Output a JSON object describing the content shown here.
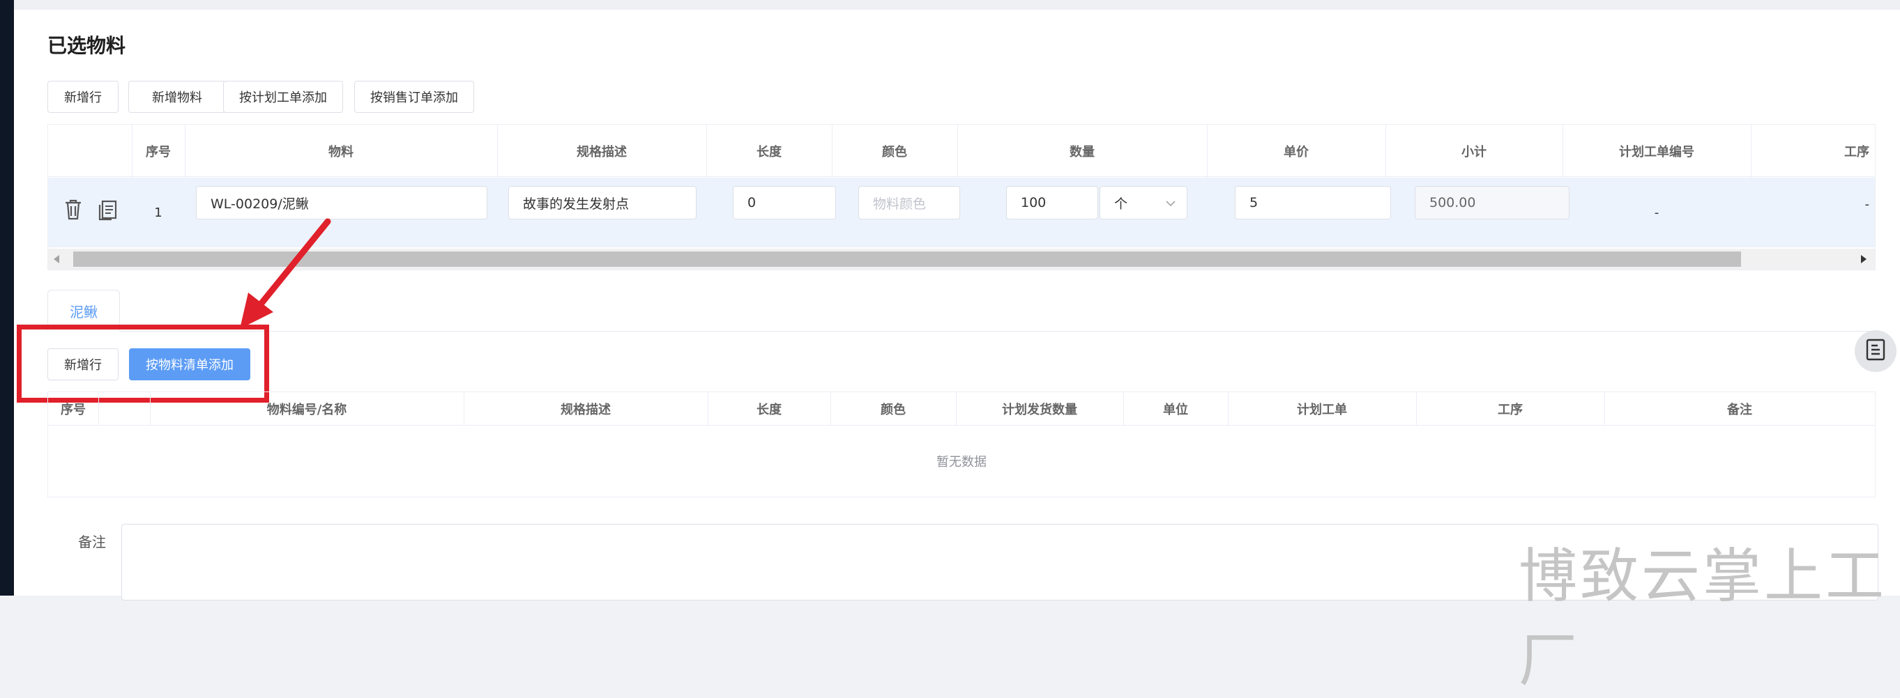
{
  "section": {
    "title": "已选物料"
  },
  "toolbar_top": {
    "buttons": [
      "新增行",
      "新增物料",
      "按计划工单添加",
      "按销售订单添加"
    ]
  },
  "table1": {
    "headers": [
      "序号",
      "物料",
      "规格描述",
      "长度",
      "颜色",
      "数量",
      "单价",
      "小计",
      "计划工单编号",
      "工序"
    ],
    "row": {
      "index": "1",
      "material": "WL-00209/泥鳅",
      "spec": "故事的发生发射点",
      "length": "0",
      "color_placeholder": "物料颜色",
      "quantity": "100",
      "unit": "个",
      "price": "5",
      "subtotal": "500.00",
      "plan_order": "-",
      "process": "-"
    }
  },
  "tabs": [
    "泥鳅"
  ],
  "toolbar_bottom": {
    "buttons": [
      "新增行",
      "按物料清单添加"
    ]
  },
  "table2": {
    "headers": [
      "序号",
      "物料编号/名称",
      "规格描述",
      "长度",
      "颜色",
      "计划发货数量",
      "单位",
      "计划工单",
      "工序",
      "备注"
    ],
    "empty_text": "暂无数据"
  },
  "remarks": {
    "label": "备注"
  },
  "watermark": "博致云掌上工厂",
  "colors": {
    "primary": "#5c9cf5",
    "highlight_row": "#edf3fd",
    "annotation_red": "#e0202a"
  }
}
